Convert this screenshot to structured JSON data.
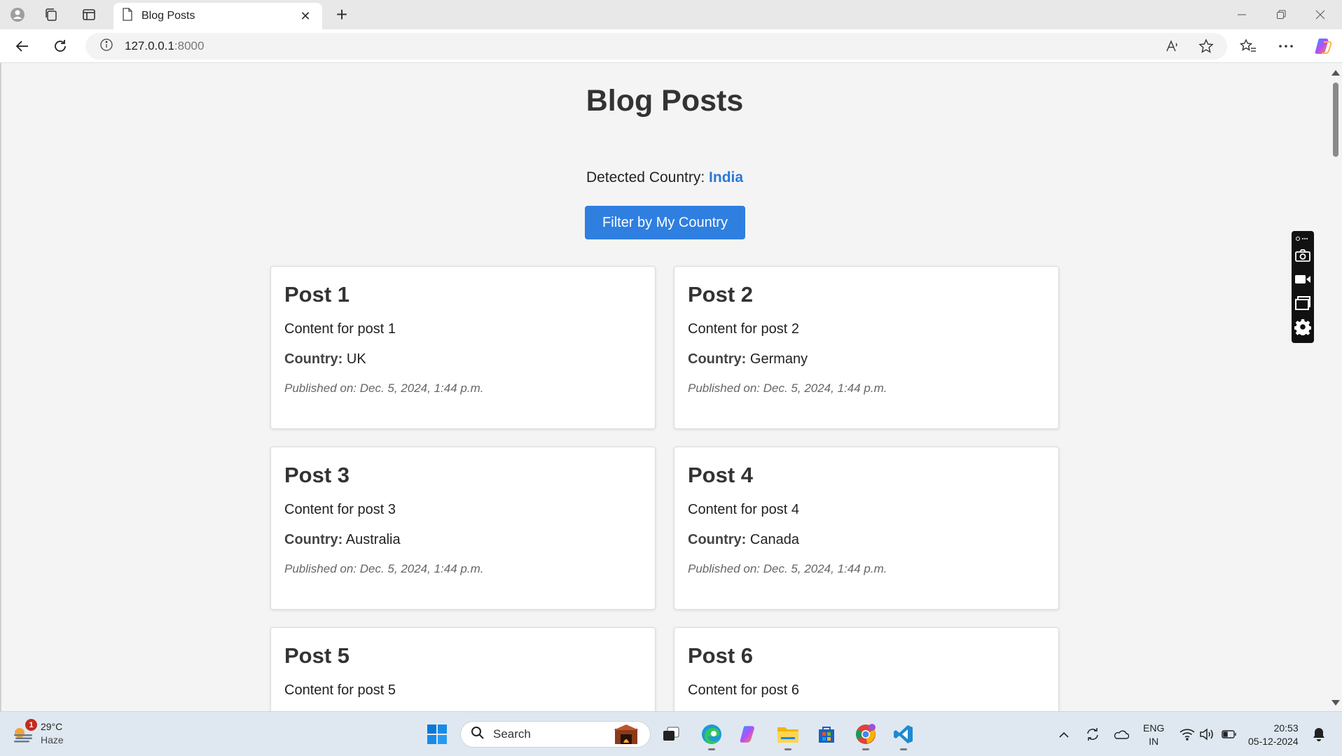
{
  "browser": {
    "tab_title": "Blog Posts",
    "url_host": "127.0.0.1",
    "url_port": ":8000"
  },
  "page": {
    "title": "Blog Posts",
    "detected_label": "Detected Country: ",
    "detected_country": "India",
    "filter_button": "Filter by My Country",
    "country_label": "Country:",
    "posts": [
      {
        "title": "Post 1",
        "content": "Content for post 1",
        "country": "UK",
        "published": "Published on: Dec. 5, 2024, 1:44 p.m."
      },
      {
        "title": "Post 2",
        "content": "Content for post 2",
        "country": "Germany",
        "published": "Published on: Dec. 5, 2024, 1:44 p.m."
      },
      {
        "title": "Post 3",
        "content": "Content for post 3",
        "country": "Australia",
        "published": "Published on: Dec. 5, 2024, 1:44 p.m."
      },
      {
        "title": "Post 4",
        "content": "Content for post 4",
        "country": "Canada",
        "published": "Published on: Dec. 5, 2024, 1:44 p.m."
      },
      {
        "title": "Post 5",
        "content": "Content for post 5",
        "country": "",
        "published": ""
      },
      {
        "title": "Post 6",
        "content": "Content for post 6",
        "country": "",
        "published": ""
      }
    ]
  },
  "taskbar": {
    "weather_badge": "1",
    "weather_temp": "29°C",
    "weather_cond": "Haze",
    "search_placeholder": "Search",
    "lang_top": "ENG",
    "lang_bottom": "IN",
    "time": "20:53",
    "date": "05-12-2024"
  },
  "icons": [
    "profile-icon",
    "collections-icon",
    "vertical-tabs-icon",
    "page-icon",
    "close-icon",
    "new-tab-icon",
    "minimize-icon",
    "restore-icon",
    "back-icon",
    "refresh-icon",
    "info-icon",
    "read-aloud-icon",
    "favorite-star-icon",
    "favorites-icon",
    "more-icon",
    "copilot-icon",
    "camera-icon",
    "video-icon",
    "window-icon",
    "gear-icon",
    "windows-start-icon",
    "search-icon",
    "file-explorer-icon",
    "edge-icon",
    "store-icon",
    "chrome-icon",
    "vscode-icon",
    "wifi-icon",
    "volume-icon",
    "battery-icon",
    "bell-icon"
  ],
  "colors": {
    "accent_blue": "#2f7fe0",
    "country_link": "#2b78d8",
    "page_bg": "#f4f4f4",
    "card_bg": "#ffffff"
  }
}
